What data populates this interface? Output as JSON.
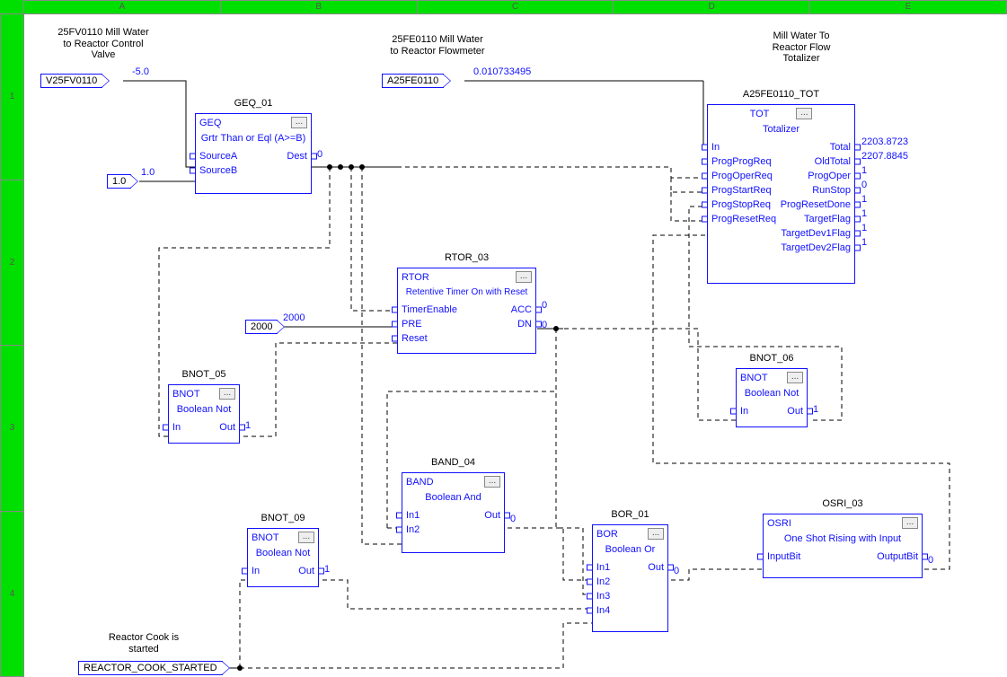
{
  "ruler": {
    "cols": [
      "A",
      "B",
      "C",
      "D",
      "E"
    ],
    "rows": [
      "1",
      "2",
      "3",
      "4"
    ]
  },
  "labels": {
    "v25fv0110_desc": "25FV0110 Mill Water\nto Reactor Control\nValve",
    "a25fe0110_desc": "25FE0110 Mill Water\nto Reactor Flowmeter",
    "tot_desc": "Mill Water To\nReactor Flow\nTotalizer",
    "reactor_cook": "Reactor Cook is\nstarted"
  },
  "irefs": {
    "v25fv0110": "V25FV0110",
    "a25fe0110": "A25FE0110",
    "one": "1.0",
    "twothousand": "2000",
    "reactor_cook_started": "REACTOR_COOK_STARTED"
  },
  "values": {
    "v25fv0110_out": "-5.0",
    "a25fe0110_out": "0.010733495",
    "one_out": "1.0",
    "twothousand_out": "2000"
  },
  "blocks": {
    "geq01": {
      "title": "GEQ_01",
      "type": "GEQ",
      "desc": "Grtr Than or Eql (A>=B)",
      "pins": {
        "srcA": "SourceA",
        "srcB": "SourceB",
        "dest": "Dest"
      },
      "destVal": "0"
    },
    "rtor03": {
      "title": "RTOR_03",
      "type": "RTOR",
      "desc": "Retentive Timer On with Reset",
      "pins": {
        "te": "TimerEnable",
        "pre": "PRE",
        "reset": "Reset",
        "acc": "ACC",
        "dn": "DN"
      },
      "accVal": "0",
      "dnVal": "0"
    },
    "bnot05": {
      "title": "BNOT_05",
      "type": "BNOT",
      "desc": "Boolean Not",
      "pins": {
        "in": "In",
        "out": "Out"
      },
      "outVal": "1"
    },
    "bnot06": {
      "title": "BNOT_06",
      "type": "BNOT",
      "desc": "Boolean Not",
      "pins": {
        "in": "In",
        "out": "Out"
      },
      "outVal": "1"
    },
    "bnot09": {
      "title": "BNOT_09",
      "type": "BNOT",
      "desc": "Boolean Not",
      "pins": {
        "in": "In",
        "out": "Out"
      },
      "outVal": "1"
    },
    "band04": {
      "title": "BAND_04",
      "type": "BAND",
      "desc": "Boolean And",
      "pins": {
        "in1": "In1",
        "in2": "In2",
        "out": "Out"
      },
      "outVal": "0"
    },
    "bor01": {
      "title": "BOR_01",
      "type": "BOR",
      "desc": "Boolean Or",
      "pins": {
        "in1": "In1",
        "in2": "In2",
        "in3": "In3",
        "in4": "In4",
        "out": "Out"
      },
      "outVal": "0"
    },
    "osri03": {
      "title": "OSRI_03",
      "type": "OSRI",
      "desc": "One Shot Rising with Input",
      "pins": {
        "inBit": "InputBit",
        "outBit": "OutputBit"
      },
      "outVal": "0"
    },
    "tot": {
      "title": "A25FE0110_TOT",
      "type": "TOT",
      "desc": "Totalizer",
      "left": [
        "In",
        "ProgProgReq",
        "ProgOperReq",
        "ProgStartReq",
        "ProgStopReq",
        "ProgResetReq"
      ],
      "right": [
        "Total",
        "OldTotal",
        "ProgOper",
        "RunStop",
        "ProgResetDone",
        "TargetFlag",
        "TargetDev1Flag",
        "TargetDev2Flag"
      ],
      "rightVals": [
        "2203.8723",
        "2207.8845",
        "1",
        "0",
        "1",
        "1",
        "1",
        "1"
      ]
    }
  }
}
